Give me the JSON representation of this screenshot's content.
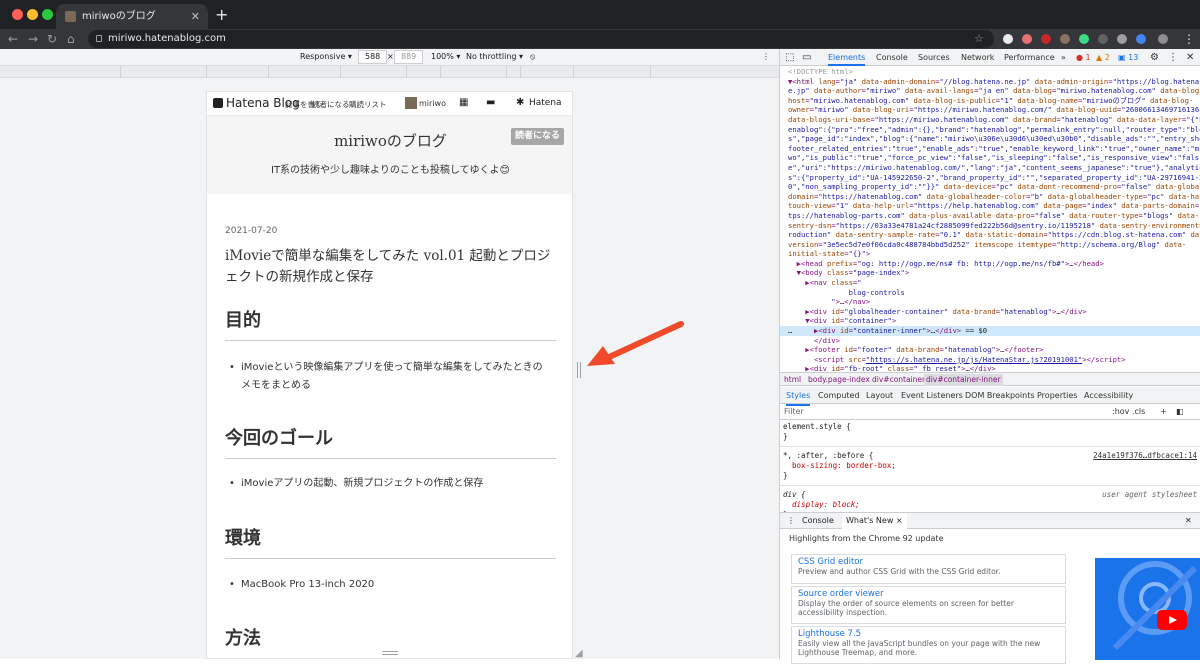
{
  "browser": {
    "tab_title": "miriwoのブログ",
    "url": "miriwo.hatenablog.com"
  },
  "device_toolbar": {
    "device": "Responsive ▾",
    "width": "588",
    "height": "889",
    "zoom": "100% ▾",
    "throttle": "No throttling ▾"
  },
  "hatena_bar": {
    "logo": "Hatena Blog",
    "menu1": "記事を書く",
    "menu2": "読者になる",
    "menu3": "購読リスト",
    "user": "miriwo",
    "brand": "Hatena"
  },
  "blog": {
    "title": "miriwoのブログ",
    "subscribe": "読者になる",
    "description": "IT系の技術や少し趣味よりのことも投稿してゆくよ😊",
    "date": "2021-07-20",
    "entry_title": "iMovieで簡単な編集をしてみた vol.01 起動とプロジェクトの新規作成と保存",
    "sections": [
      {
        "heading": "目的",
        "items": [
          "iMovieという映像編集アプリを使って簡単な編集をしてみたときのメモをまとめる"
        ]
      },
      {
        "heading": "今回のゴール",
        "items": [
          "iMovieアプリの起動、新規プロジェクトの作成と保存"
        ]
      },
      {
        "heading": "環境",
        "items": [
          "MacBook Pro 13-inch 2020"
        ]
      },
      {
        "heading": "方法",
        "items": []
      }
    ]
  },
  "devtools": {
    "tabs": [
      "Elements",
      "Console",
      "Sources",
      "Network",
      "Performance",
      "»"
    ],
    "badges": {
      "errors": "1",
      "warnings": "2",
      "messages": "13"
    },
    "crumbs": [
      "html",
      "body.page-index",
      "div#container",
      "div#container-inner"
    ],
    "subtabs": [
      "Styles",
      "Computed",
      "Layout",
      "Event Listeners",
      "DOM Breakpoints",
      "Properties",
      "Accessibility"
    ],
    "filter_placeholder": "Filter",
    "filter_right": ":hov  .cls",
    "styles_lines": [
      "element.style {",
      "}",
      "*, :after, :before {",
      "  box-sizing: border-box;",
      "}",
      "div {",
      "  display: block;",
      "}"
    ],
    "styles_source": "24a1e19f376…dfbcace1:14",
    "styles_ua": "user agent stylesheet",
    "drawer_tabs": [
      "Console",
      "What's New ×"
    ],
    "whatsnew_head": "Highlights from the Chrome 92 update",
    "cards": [
      {
        "title": "CSS Grid editor",
        "desc": "Preview and author CSS Grid with the CSS Grid editor."
      },
      {
        "title": "Source order viewer",
        "desc": "Display the order of source elements on screen for better accessibility inspection."
      },
      {
        "title": "Lighthouse 7.5",
        "desc": "Easily view all the JavaScript bundles on your page with the new Lighthouse Treemap, and more."
      }
    ]
  }
}
